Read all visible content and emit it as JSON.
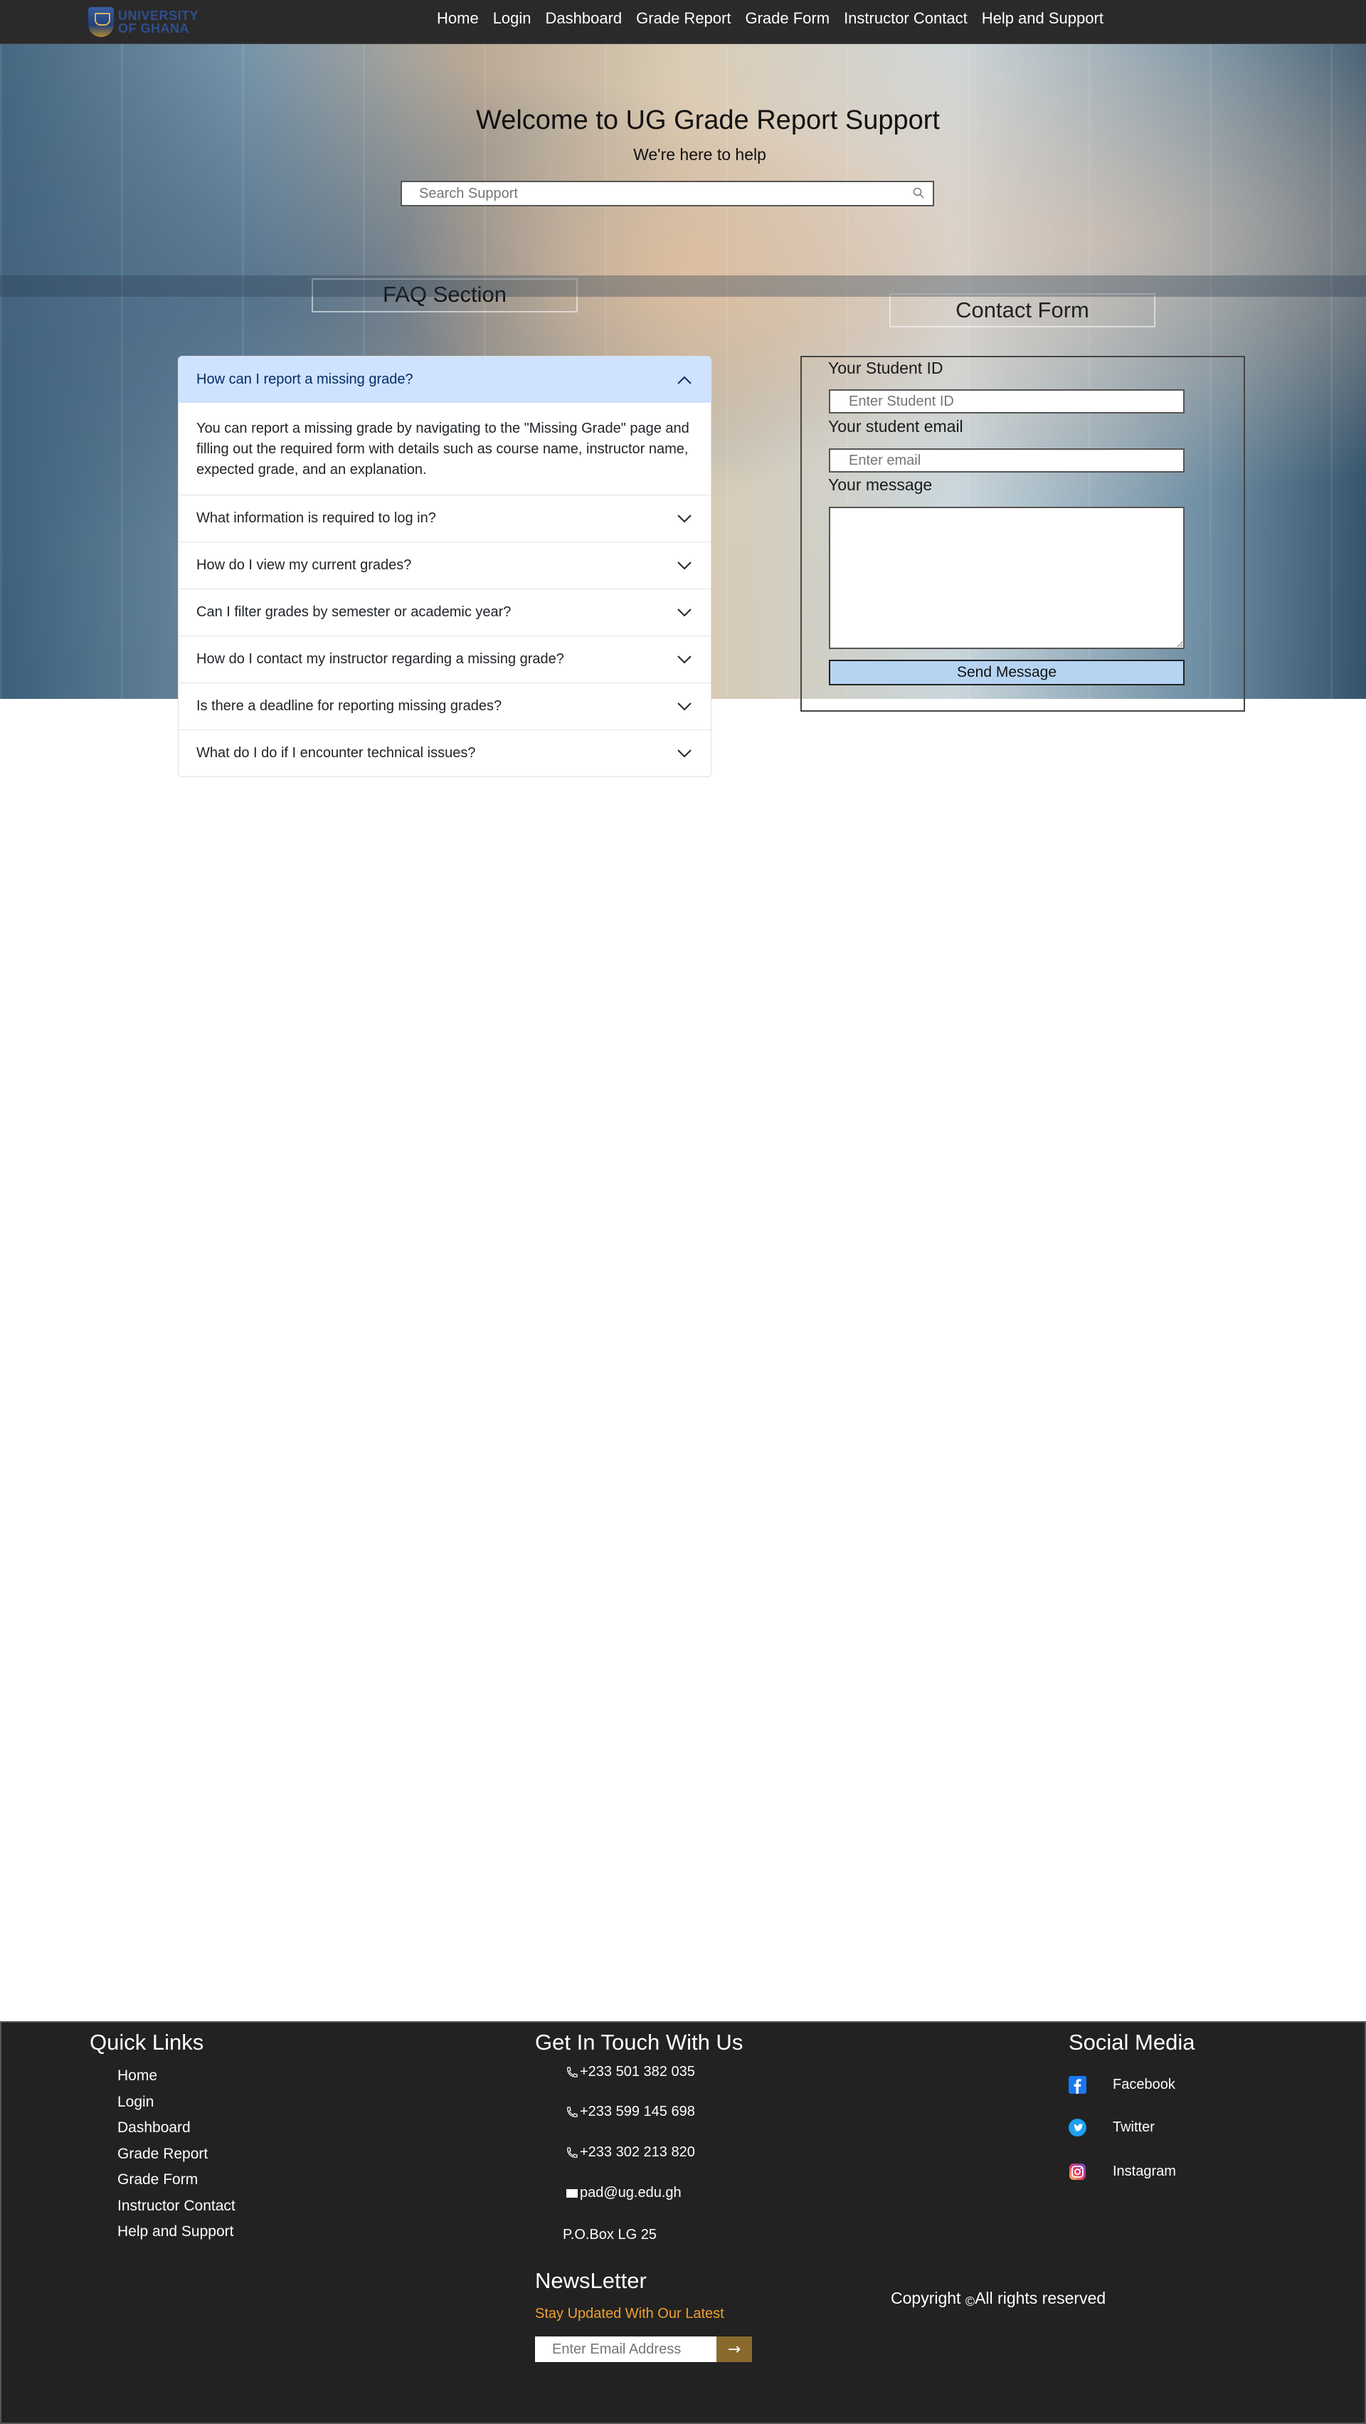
{
  "navbar": {
    "logo_text_line1": "UNIVERSITY",
    "logo_text_line2": "OF GHANA",
    "links": [
      "Home",
      "Login",
      "Dashboard",
      "Grade Report",
      "Grade Form",
      "Instructor Contact",
      "Help and Support"
    ]
  },
  "hero": {
    "title": "Welcome to UG Grade Report Support",
    "subtitle": "We're here to help",
    "search_placeholder": "Search Support"
  },
  "faq": {
    "title": "FAQ Section",
    "items": [
      {
        "question": "How can I report a missing grade?",
        "answer": "You can report a missing grade by navigating to the \"Missing Grade\" page and filling out the required form with details such as course name, instructor name, expected grade, and an explanation.",
        "open": true
      },
      {
        "question": "What information is required to log in?"
      },
      {
        "question": "How do I view my current grades?"
      },
      {
        "question": "Can I filter grades by semester or academic year?"
      },
      {
        "question": "How do I contact my instructor regarding a missing grade?"
      },
      {
        "question": "Is there a deadline for reporting missing grades?"
      },
      {
        "question": "What do I do if I encounter technical issues?"
      }
    ]
  },
  "contact": {
    "title": "Contact Form",
    "student_id_label": "Your Student ID",
    "student_id_placeholder": "Enter Student ID",
    "email_label": "Your student email",
    "email_placeholder": "Enter email",
    "message_label": "Your message",
    "send_label": "Send Message"
  },
  "footer": {
    "quick_links_title": "Quick Links",
    "quick_links": [
      "Home",
      "Login",
      "Dashboard",
      "Grade Report",
      "Grade Form",
      "Instructor Contact",
      "Help and Support"
    ],
    "get_in_touch_title": "Get In Touch With Us",
    "phones": [
      "+233 501 382 035",
      "+233 599 145 698",
      "+233 302 213 820"
    ],
    "email": "pad@ug.edu.gh",
    "pobox": "P.O.Box LG 25",
    "social_title": "Social Media",
    "social": [
      {
        "label": "Facebook",
        "icon": "facebook-icon",
        "color": "#1877f2"
      },
      {
        "label": "Twitter",
        "icon": "twitter-icon",
        "color": "#1da1f2"
      },
      {
        "label": "Instagram",
        "icon": "instagram-icon",
        "color": "#c13584"
      }
    ],
    "newsletter_title": "NewsLetter",
    "newsletter_subtitle": "Stay Updated With Our Latest",
    "newsletter_placeholder": "Enter Email Address",
    "newsletter_button": "→",
    "copyright_prefix": "Copyright",
    "copyright_symbol": "©",
    "copyright_suffix": "All rights reserved"
  },
  "colors": {
    "navbar_bg": "#2b2a2a",
    "footer_bg": "#222222",
    "accordion_active_bg": "#cfe2ff",
    "send_button_bg": "#b6d4f2",
    "newsletter_accent": "#f0a030",
    "newsletter_button_bg": "#8a6a2c"
  }
}
